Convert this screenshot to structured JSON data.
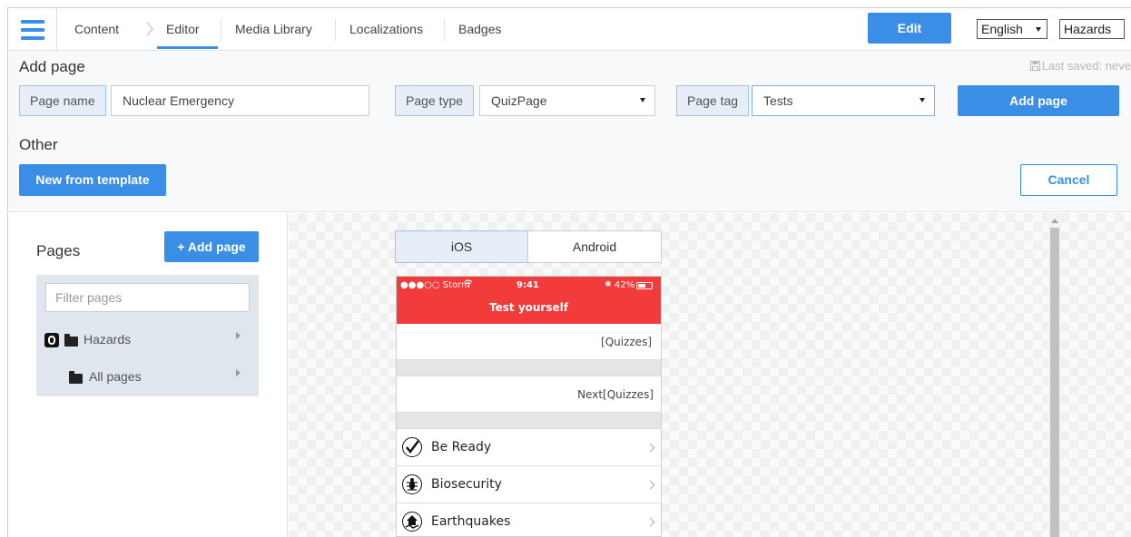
{
  "nav": {
    "items": [
      "Content",
      "Editor",
      "Media Library",
      "Localizations",
      "Badges"
    ],
    "edit_label": "Edit",
    "language": "English",
    "app": "Hazards"
  },
  "add_page": {
    "title": "Add page",
    "last_saved": "Last saved: neve",
    "page_name_label": "Page name",
    "page_name_value": "Nuclear Emergency",
    "page_type_label": "Page type",
    "page_type_value": "QuizPage",
    "page_tag_label": "Page tag",
    "page_tag_value": "Tests",
    "add_button": "Add page",
    "other_title": "Other",
    "new_template_button": "New from template",
    "cancel_button": "Cancel"
  },
  "sidebar": {
    "title": "Pages",
    "add_button": "+ Add page",
    "filter_placeholder": "Filter pages",
    "tree": [
      {
        "label": "Hazards"
      },
      {
        "label": "All pages"
      }
    ]
  },
  "preview": {
    "tabs": [
      "iOS",
      "Android"
    ],
    "status_left": "●●●○○ Storm",
    "status_time": "9:41",
    "status_right": "42%",
    "title": "Test yourself",
    "row1": "[Quizzes]",
    "row2": "Next[Quizzes]",
    "list": [
      {
        "label": "Be Ready",
        "icon": "check-icon"
      },
      {
        "label": "Biosecurity",
        "icon": "bug-icon"
      },
      {
        "label": "Earthquakes",
        "icon": "earthquake-icon"
      }
    ]
  },
  "colors": {
    "accent": "#3a8ee6",
    "header_red": "#f23b3b"
  }
}
